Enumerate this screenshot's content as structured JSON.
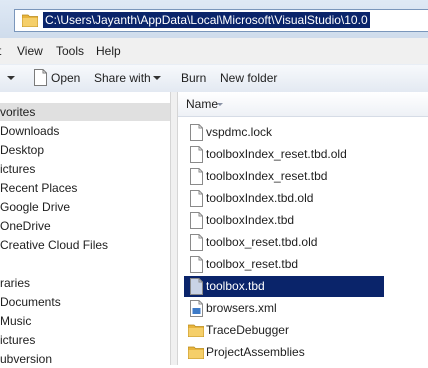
{
  "address": {
    "path": "C:\\Users\\Jayanth\\AppData\\Local\\Microsoft\\VisualStudio\\10.0"
  },
  "menu": {
    "items": [
      "t",
      "View",
      "Tools",
      "Help"
    ]
  },
  "toolbar": {
    "open": "Open",
    "share_with": "Share with",
    "burn": "Burn",
    "new_folder": "New folder"
  },
  "nav": {
    "items": [
      "vorites",
      "Downloads",
      "Desktop",
      "ictures",
      "Recent Places",
      "Google Drive",
      "OneDrive",
      "Creative Cloud Files",
      "",
      "raries",
      "Documents",
      "Music",
      "ictures",
      "ubversion"
    ]
  },
  "files": {
    "header": "Name",
    "items": [
      {
        "name": "vspdmc.lock",
        "type": "file"
      },
      {
        "name": "toolboxIndex_reset.tbd.old",
        "type": "file"
      },
      {
        "name": "toolboxIndex_reset.tbd",
        "type": "file"
      },
      {
        "name": "toolboxIndex.tbd.old",
        "type": "file"
      },
      {
        "name": "toolboxIndex.tbd",
        "type": "file"
      },
      {
        "name": "toolbox_reset.tbd.old",
        "type": "file"
      },
      {
        "name": "toolbox_reset.tbd",
        "type": "file"
      },
      {
        "name": "toolbox.tbd",
        "type": "file"
      },
      {
        "name": "browsers.xml",
        "type": "xml"
      },
      {
        "name": "TraceDebugger",
        "type": "folder"
      },
      {
        "name": "ProjectAssemblies",
        "type": "folder"
      }
    ],
    "selected": "toolbox.tbd"
  },
  "colors": {
    "selection": "#0a246a",
    "folder": "#e8b43c"
  }
}
